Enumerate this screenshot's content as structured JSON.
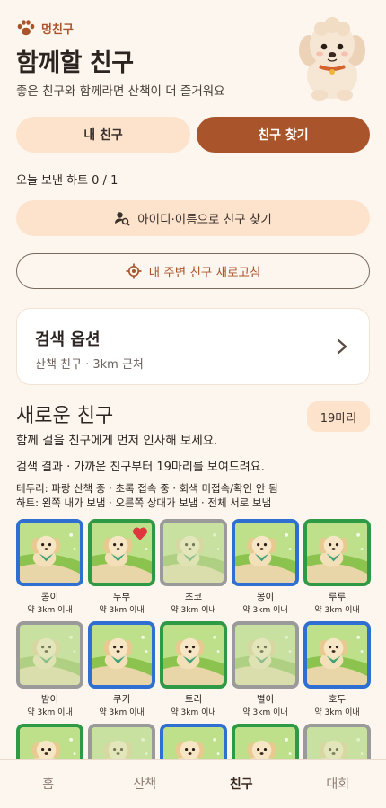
{
  "header": {
    "brand": "멍친구",
    "title": "함께할 친구",
    "subtitle": "좋은 친구와 함께라면 산책이 더 즐거워요"
  },
  "segments": {
    "mine": "내 친구",
    "find": "친구 찾기"
  },
  "hearts": "오늘 보낸 하트 0 / 1",
  "actions": {
    "search_by_id": "아이디·이름으로 친구 찾기",
    "refresh_nearby": "내 주변 친구 새로고침"
  },
  "search_options": {
    "title": "검색 옵션",
    "summary": "산책 친구 · 3km 근처"
  },
  "new_friends": {
    "title": "새로운 친구",
    "count": "19마리",
    "intro": "함께 걸을 친구에게 먼저 인사해 보세요.",
    "result": "검색 결과 · 가까운 친구부터 19마리를 보여드려요.",
    "legend_border": "테두리: 파랑 산책 중 · 초록 접속 중 · 회색 미접속/확인 안 됨",
    "legend_heart": "하트: 왼쪽 내가 보냄 · 오른쪽 상대가 보냄 · 전체 서로 보냄"
  },
  "friends": [
    {
      "name": "콩이",
      "distance": "약 3km 이내",
      "status": "blue",
      "heart": false
    },
    {
      "name": "두부",
      "distance": "약 3km 이내",
      "status": "green",
      "heart": true
    },
    {
      "name": "초코",
      "distance": "약 3km 이내",
      "status": "gray",
      "heart": false
    },
    {
      "name": "몽이",
      "distance": "약 3km 이내",
      "status": "blue",
      "heart": false
    },
    {
      "name": "루루",
      "distance": "약 3km 이내",
      "status": "green",
      "heart": false
    },
    {
      "name": "밤이",
      "distance": "약 3km 이내",
      "status": "gray",
      "heart": false
    },
    {
      "name": "쿠키",
      "distance": "약 3km 이내",
      "status": "blue",
      "heart": false
    },
    {
      "name": "토리",
      "distance": "약 3km 이내",
      "status": "green",
      "heart": false
    },
    {
      "name": "별이",
      "distance": "약 3km 이내",
      "status": "gray",
      "heart": false
    },
    {
      "name": "호두",
      "distance": "약 3km 이내",
      "status": "blue",
      "heart": false
    },
    {
      "name": "",
      "distance": "",
      "status": "green",
      "heart": false
    },
    {
      "name": "",
      "distance": "",
      "status": "gray",
      "heart": false
    },
    {
      "name": "",
      "distance": "",
      "status": "blue",
      "heart": false
    },
    {
      "name": "",
      "distance": "",
      "status": "green",
      "heart": false
    },
    {
      "name": "",
      "distance": "",
      "status": "gray",
      "heart": false
    }
  ],
  "tabs": [
    "홈",
    "산책",
    "친구",
    "대회"
  ],
  "active_tab": "친구",
  "colors": {
    "accent": "#a9542a",
    "soft": "#fde2cc",
    "background": "#fdf6ee",
    "walking": "#2f6fd1",
    "online": "#2e9a46",
    "offline": "#9a9a9a",
    "heart": "#e0363e"
  }
}
